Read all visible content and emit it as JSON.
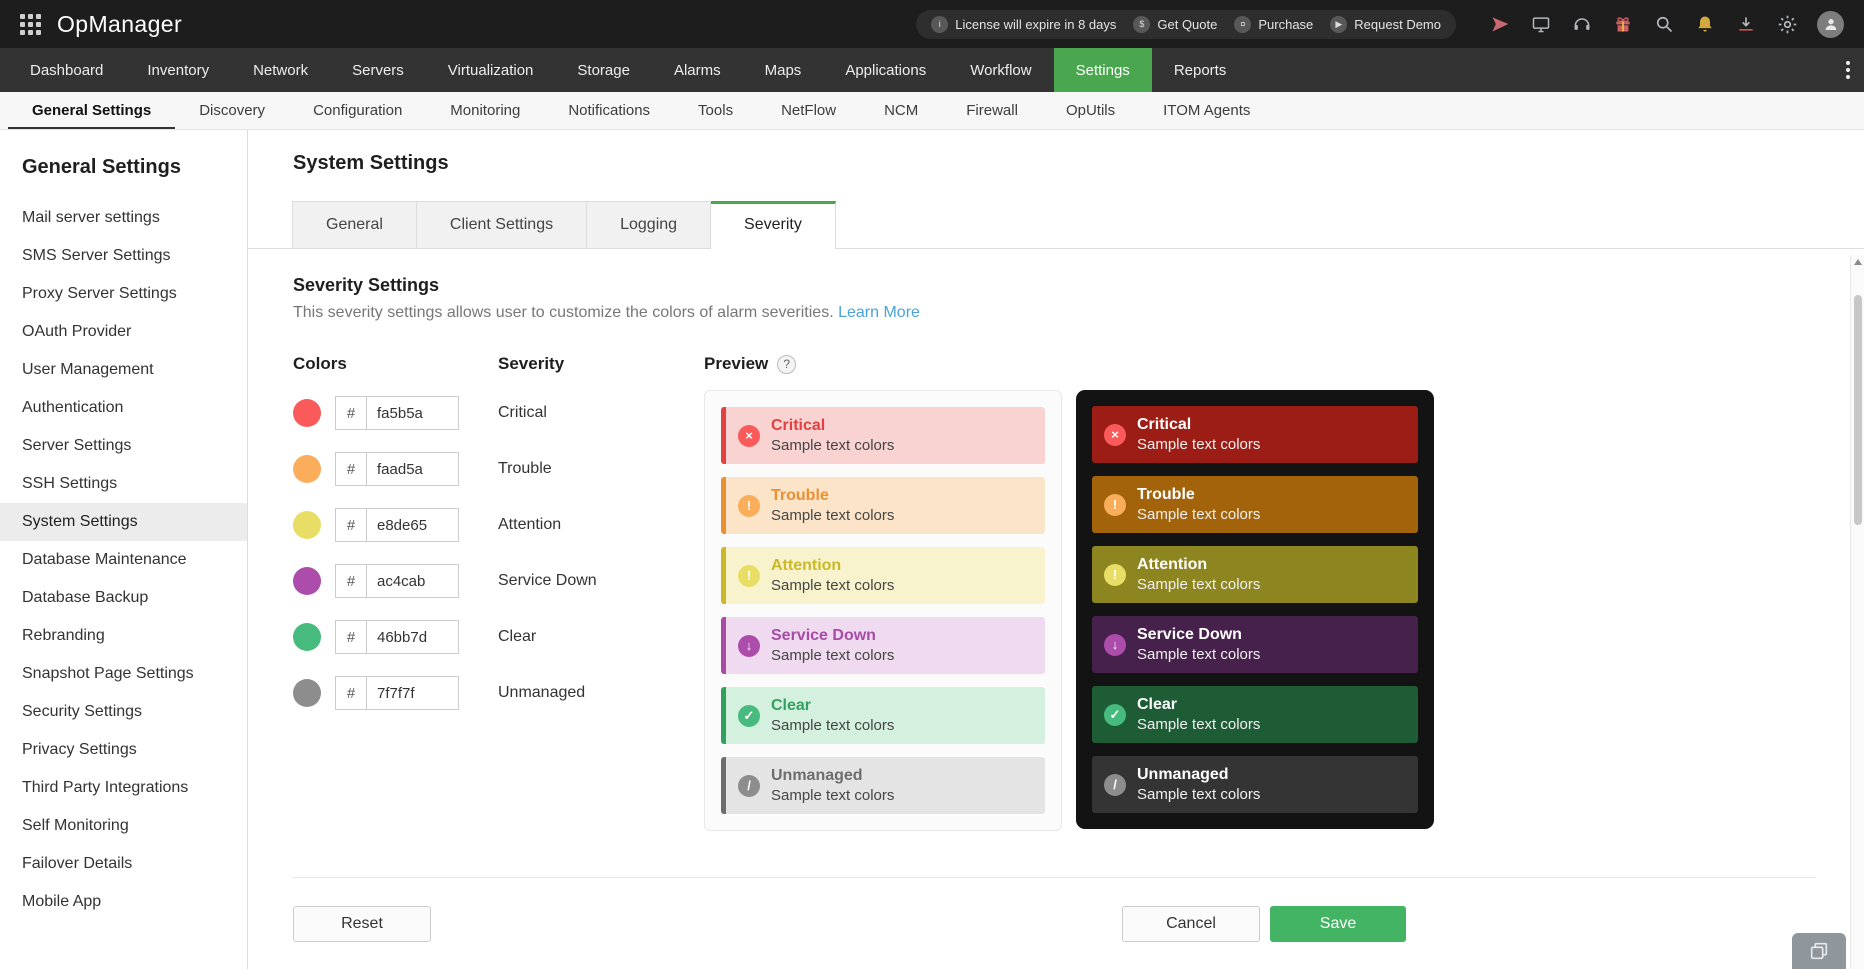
{
  "topbar": {
    "brand": "OpManager",
    "badges": [
      {
        "icon": "license-icon",
        "glyph": "i",
        "label": "License will expire in 8 days"
      },
      {
        "icon": "get-quote-icon",
        "glyph": "$",
        "label": "Get Quote"
      },
      {
        "icon": "purchase-icon",
        "glyph": "¤",
        "label": "Purchase"
      },
      {
        "icon": "request-demo-icon",
        "glyph": "▶",
        "label": "Request Demo"
      }
    ]
  },
  "nav": {
    "items": [
      "Dashboard",
      "Inventory",
      "Network",
      "Servers",
      "Virtualization",
      "Storage",
      "Alarms",
      "Maps",
      "Applications",
      "Workflow",
      "Settings",
      "Reports"
    ],
    "active": "Settings"
  },
  "subnav": {
    "items": [
      "General Settings",
      "Discovery",
      "Configuration",
      "Monitoring",
      "Notifications",
      "Tools",
      "NetFlow",
      "NCM",
      "Firewall",
      "OpUtils",
      "ITOM Agents"
    ],
    "active": "General Settings"
  },
  "sidebar": {
    "title": "General Settings",
    "active": "System Settings",
    "items": [
      "Mail server settings",
      "SMS Server Settings",
      "Proxy Server Settings",
      "OAuth Provider",
      "User Management",
      "Authentication",
      "Server Settings",
      "SSH Settings",
      "System Settings",
      "Database Maintenance",
      "Database Backup",
      "Rebranding",
      "Snapshot Page Settings",
      "Security Settings",
      "Privacy Settings",
      "Third Party Integrations",
      "Self Monitoring",
      "Failover Details",
      "Mobile App"
    ]
  },
  "main": {
    "title": "System Settings",
    "tabs": [
      "General",
      "Client Settings",
      "Logging",
      "Severity"
    ],
    "active_tab": "Severity",
    "section": {
      "title": "Severity Settings",
      "description": "This severity settings allows user to customize the colors of alarm severities.",
      "link": "Learn More"
    },
    "headers": {
      "colors": "Colors",
      "severity": "Severity",
      "preview": "Preview",
      "help": "?"
    },
    "hash_prefix": "#",
    "sample_text": "Sample text colors",
    "severities": [
      {
        "name": "Critical",
        "hex": "fa5b5a",
        "base": "#fa5b5a",
        "light_bg": "#f9d2d2",
        "light_title": "#e2413f",
        "dark_bg": "#9b1d15",
        "glyph": "×"
      },
      {
        "name": "Trouble",
        "hex": "faad5a",
        "base": "#faad5a",
        "light_bg": "#fce4c8",
        "light_title": "#eb8f33",
        "dark_bg": "#a2630b",
        "glyph": "!"
      },
      {
        "name": "Attention",
        "hex": "e8de65",
        "base": "#e8de65",
        "light_bg": "#f8f3cd",
        "light_title": "#c9b929",
        "dark_bg": "#8d851f",
        "glyph": "!"
      },
      {
        "name": "Service Down",
        "hex": "ac4cab",
        "base": "#ac4cab",
        "light_bg": "#f0daf0",
        "light_title": "#a84ba7",
        "dark_bg": "#46214b",
        "glyph": "↓"
      },
      {
        "name": "Clear",
        "hex": "46bb7d",
        "base": "#46bb7d",
        "light_bg": "#d4f0de",
        "light_title": "#31a160",
        "dark_bg": "#1e5c36",
        "glyph": "✓"
      },
      {
        "name": "Unmanaged",
        "hex": "7f7f7f",
        "base": "#8d8d8d",
        "light_bg": "#e4e4e4",
        "light_title": "#6d6d6d",
        "dark_bg": "#343434",
        "glyph": "/"
      }
    ],
    "buttons": {
      "reset": "Reset",
      "cancel": "Cancel",
      "save": "Save"
    }
  },
  "theme": {
    "nav_active_green": "#4aa64f",
    "save_green": "#43b364",
    "link_blue": "#4aa3d8"
  }
}
